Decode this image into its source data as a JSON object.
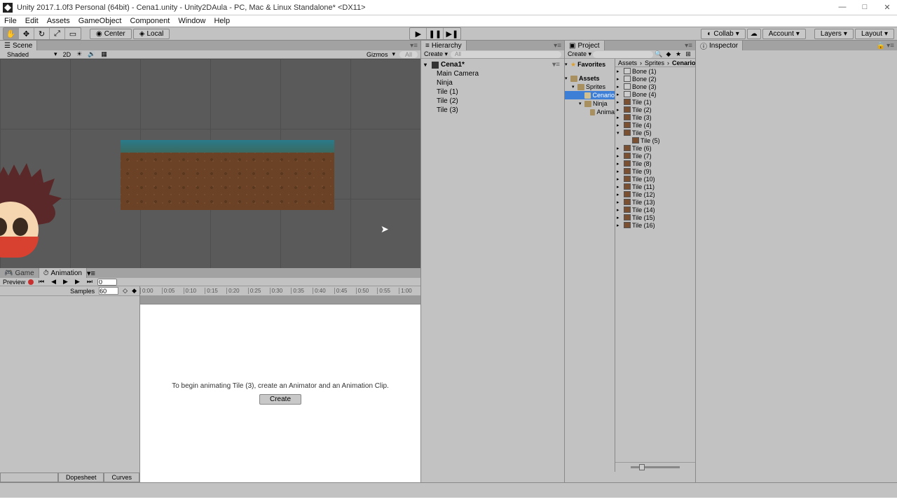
{
  "window": {
    "title": "Unity 2017.1.0f3 Personal (64bit) - Cena1.unity - Unity2DAula - PC, Mac & Linux Standalone* <DX11>"
  },
  "menu": [
    "File",
    "Edit",
    "Assets",
    "GameObject",
    "Component",
    "Window",
    "Help"
  ],
  "toolbar": {
    "center": "Center",
    "local": "Local",
    "collab": "Collab",
    "account": "Account",
    "layers": "Layers",
    "layout": "Layout"
  },
  "scene": {
    "tab": "Scene",
    "shaded": "Shaded",
    "mode2d": "2D",
    "gizmos": "Gizmos",
    "search_placeholder": "All"
  },
  "game_tab": "Game",
  "animation_tab": "Animation",
  "animation": {
    "preview": "Preview",
    "samples_label": "Samples",
    "samples_value": "60",
    "frame": "0",
    "timeline": [
      "0:00",
      "0:05",
      "0:10",
      "0:15",
      "0:20",
      "0:25",
      "0:30",
      "0:35",
      "0:40",
      "0:45",
      "0:50",
      "0:55",
      "1:00"
    ],
    "msg": "To begin animating Tile (3), create an Animator and an Animation Clip.",
    "create": "Create",
    "dopesheet": "Dopesheet",
    "curves": "Curves"
  },
  "hierarchy": {
    "tab": "Hierarchy",
    "create": "Create",
    "search_placeholder": "All",
    "scene": "Cena1*",
    "items": [
      "Main Camera",
      "Ninja",
      "Tile (1)",
      "Tile (2)",
      "Tile (3)"
    ]
  },
  "project": {
    "tab": "Project",
    "create": "Create",
    "favorites": "Favorites",
    "assets": "Assets",
    "sprites": "Sprites",
    "cenario": "Cenario",
    "ninja": "Ninja",
    "anima": "Anima",
    "breadcrumb": [
      "Assets",
      "Sprites",
      "Cenario"
    ],
    "bones": [
      "Bone (1)",
      "Bone (2)",
      "Bone (3)",
      "Bone (4)"
    ],
    "tiles": [
      "Tile (1)",
      "Tile (2)",
      "Tile (3)",
      "Tile (4)",
      "Tile (5)",
      "Tile (5)",
      "Tile (6)",
      "Tile (7)",
      "Tile (8)",
      "Tile (9)",
      "Tile (10)",
      "Tile (11)",
      "Tile (12)",
      "Tile (13)",
      "Tile (14)",
      "Tile (15)",
      "Tile (16)"
    ]
  },
  "inspector": {
    "tab": "Inspector"
  }
}
